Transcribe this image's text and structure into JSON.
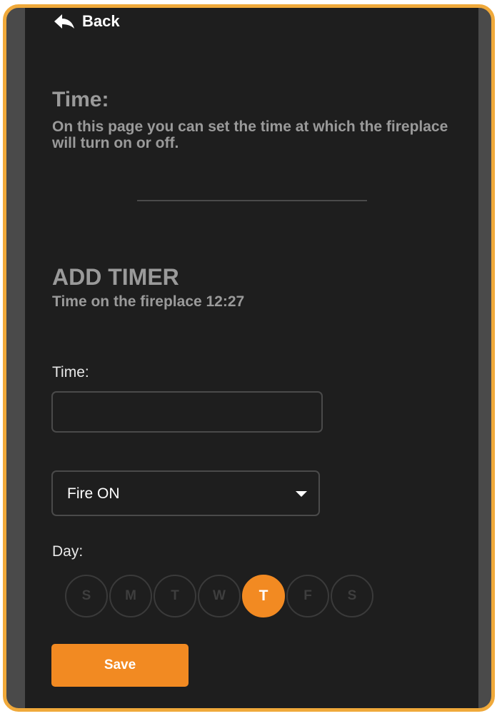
{
  "nav": {
    "back_label": "Back",
    "back_icon": "reply-arrow-icon"
  },
  "page": {
    "title": "Time:",
    "description": "On this page you can set the time at which the fireplace will turn on or off."
  },
  "add_timer": {
    "title": "ADD TIMER",
    "subtitle": "Time on the fireplace 12:27"
  },
  "form": {
    "time_label": "Time:",
    "time_value": "",
    "mode_select": {
      "selected": "Fire ON",
      "icon": "caret-down-icon"
    },
    "day_label": "Day:",
    "days": [
      {
        "letter": "S",
        "selected": false
      },
      {
        "letter": "M",
        "selected": false
      },
      {
        "letter": "T",
        "selected": false
      },
      {
        "letter": "W",
        "selected": false
      },
      {
        "letter": "T",
        "selected": true
      },
      {
        "letter": "F",
        "selected": false
      },
      {
        "letter": "S",
        "selected": false
      }
    ],
    "save_label": "Save"
  },
  "colors": {
    "accent": "#f28a22",
    "frame": "#f0a93a",
    "background": "#1e1e1e",
    "muted_text": "#9a9a9a"
  }
}
